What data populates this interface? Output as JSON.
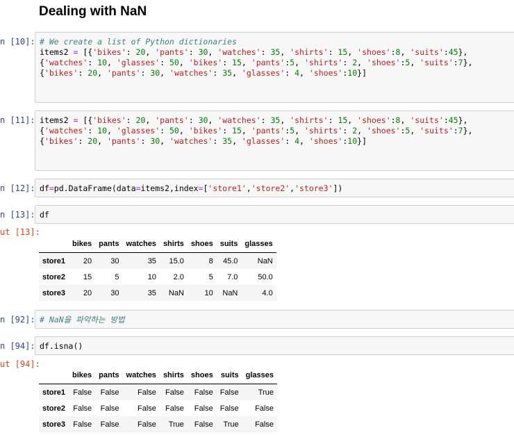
{
  "title": "Dealing with NaN",
  "cells": [
    {
      "prompt": "n [10]:",
      "lines": [
        [
          [
            "cm",
            "# We create a list of Python dictionaries"
          ]
        ],
        [
          [
            "",
            "items2 "
          ],
          [
            "op",
            "="
          ],
          [
            "",
            " [{"
          ],
          [
            "st",
            "'bikes'"
          ],
          [
            "",
            ": "
          ],
          [
            "nu",
            "20"
          ],
          [
            "",
            ", "
          ],
          [
            "st",
            "'pants'"
          ],
          [
            "",
            ": "
          ],
          [
            "nu",
            "30"
          ],
          [
            "",
            ", "
          ],
          [
            "st",
            "'watches'"
          ],
          [
            "",
            ": "
          ],
          [
            "nu",
            "35"
          ],
          [
            "",
            ", "
          ],
          [
            "st",
            "'shirts'"
          ],
          [
            "",
            ": "
          ],
          [
            "nu",
            "15"
          ],
          [
            "",
            ", "
          ],
          [
            "st",
            "'shoes'"
          ],
          [
            "",
            ":"
          ],
          [
            "nu",
            "8"
          ],
          [
            "",
            ", "
          ],
          [
            "st",
            "'suits'"
          ],
          [
            "",
            ":"
          ],
          [
            "nu",
            "45"
          ],
          [
            "",
            "},"
          ]
        ],
        [
          [
            "",
            "{"
          ],
          [
            "st",
            "'watches'"
          ],
          [
            "",
            ": "
          ],
          [
            "nu",
            "10"
          ],
          [
            "",
            ", "
          ],
          [
            "st",
            "'glasses'"
          ],
          [
            "",
            ": "
          ],
          [
            "nu",
            "50"
          ],
          [
            "",
            ", "
          ],
          [
            "st",
            "'bikes'"
          ],
          [
            "",
            ": "
          ],
          [
            "nu",
            "15"
          ],
          [
            "",
            ", "
          ],
          [
            "st",
            "'pants'"
          ],
          [
            "",
            ":"
          ],
          [
            "nu",
            "5"
          ],
          [
            "",
            ", "
          ],
          [
            "st",
            "'shirts'"
          ],
          [
            "",
            ": "
          ],
          [
            "nu",
            "2"
          ],
          [
            "",
            ", "
          ],
          [
            "st",
            "'shoes'"
          ],
          [
            "",
            ":"
          ],
          [
            "nu",
            "5"
          ],
          [
            "",
            ", "
          ],
          [
            "st",
            "'suits'"
          ],
          [
            "",
            ":"
          ],
          [
            "nu",
            "7"
          ],
          [
            "",
            "},"
          ]
        ],
        [
          [
            "",
            "{"
          ],
          [
            "st",
            "'bikes'"
          ],
          [
            "",
            ": "
          ],
          [
            "nu",
            "20"
          ],
          [
            "",
            ", "
          ],
          [
            "st",
            "'pants'"
          ],
          [
            "",
            ": "
          ],
          [
            "nu",
            "30"
          ],
          [
            "",
            ", "
          ],
          [
            "st",
            "'watches'"
          ],
          [
            "",
            ": "
          ],
          [
            "nu",
            "35"
          ],
          [
            "",
            ", "
          ],
          [
            "st",
            "'glasses'"
          ],
          [
            "",
            ": "
          ],
          [
            "nu",
            "4"
          ],
          [
            "",
            ", "
          ],
          [
            "st",
            "'shoes'"
          ],
          [
            "",
            ":"
          ],
          [
            "nu",
            "10"
          ],
          [
            "",
            "}]"
          ]
        ]
      ]
    },
    {
      "prompt": "n [11]:",
      "lines": [
        [
          [
            "",
            "items2 "
          ],
          [
            "op",
            "="
          ],
          [
            "",
            " [{"
          ],
          [
            "st",
            "'bikes'"
          ],
          [
            "",
            ": "
          ],
          [
            "nu",
            "20"
          ],
          [
            "",
            ", "
          ],
          [
            "st",
            "'pants'"
          ],
          [
            "",
            ": "
          ],
          [
            "nu",
            "30"
          ],
          [
            "",
            ", "
          ],
          [
            "st",
            "'watches'"
          ],
          [
            "",
            ": "
          ],
          [
            "nu",
            "35"
          ],
          [
            "",
            ", "
          ],
          [
            "st",
            "'shirts'"
          ],
          [
            "",
            ": "
          ],
          [
            "nu",
            "15"
          ],
          [
            "",
            ", "
          ],
          [
            "st",
            "'shoes'"
          ],
          [
            "",
            ":"
          ],
          [
            "nu",
            "8"
          ],
          [
            "",
            ", "
          ],
          [
            "st",
            "'suits'"
          ],
          [
            "",
            ":"
          ],
          [
            "nu",
            "45"
          ],
          [
            "",
            "},"
          ]
        ],
        [
          [
            "",
            "{"
          ],
          [
            "st",
            "'watches'"
          ],
          [
            "",
            ": "
          ],
          [
            "nu",
            "10"
          ],
          [
            "",
            ", "
          ],
          [
            "st",
            "'glasses'"
          ],
          [
            "",
            ": "
          ],
          [
            "nu",
            "50"
          ],
          [
            "",
            ", "
          ],
          [
            "st",
            "'bikes'"
          ],
          [
            "",
            ": "
          ],
          [
            "nu",
            "15"
          ],
          [
            "",
            ", "
          ],
          [
            "st",
            "'pants'"
          ],
          [
            "",
            ":"
          ],
          [
            "nu",
            "5"
          ],
          [
            "",
            ", "
          ],
          [
            "st",
            "'shirts'"
          ],
          [
            "",
            ": "
          ],
          [
            "nu",
            "2"
          ],
          [
            "",
            ", "
          ],
          [
            "st",
            "'shoes'"
          ],
          [
            "",
            ":"
          ],
          [
            "nu",
            "5"
          ],
          [
            "",
            ", "
          ],
          [
            "st",
            "'suits'"
          ],
          [
            "",
            ":"
          ],
          [
            "nu",
            "7"
          ],
          [
            "",
            "},"
          ]
        ],
        [
          [
            "",
            "{"
          ],
          [
            "st",
            "'bikes'"
          ],
          [
            "",
            ": "
          ],
          [
            "nu",
            "20"
          ],
          [
            "",
            ", "
          ],
          [
            "st",
            "'pants'"
          ],
          [
            "",
            ": "
          ],
          [
            "nu",
            "30"
          ],
          [
            "",
            ", "
          ],
          [
            "st",
            "'watches'"
          ],
          [
            "",
            ": "
          ],
          [
            "nu",
            "35"
          ],
          [
            "",
            ", "
          ],
          [
            "st",
            "'glasses'"
          ],
          [
            "",
            ": "
          ],
          [
            "nu",
            "4"
          ],
          [
            "",
            ", "
          ],
          [
            "st",
            "'shoes'"
          ],
          [
            "",
            ":"
          ],
          [
            "nu",
            "10"
          ],
          [
            "",
            "}]"
          ]
        ]
      ]
    },
    {
      "prompt": "n [12]:",
      "lines": [
        [
          [
            "",
            "df"
          ],
          [
            "op",
            "="
          ],
          [
            "",
            "pd.DataFrame(data"
          ],
          [
            "op",
            "="
          ],
          [
            "",
            "items2,index"
          ],
          [
            "op",
            "="
          ],
          [
            "",
            "["
          ],
          [
            "st",
            "'store1'"
          ],
          [
            "",
            ","
          ],
          [
            "st",
            "'store2'"
          ],
          [
            "",
            ","
          ],
          [
            "st",
            "'store3'"
          ],
          [
            "",
            "])"
          ]
        ]
      ]
    },
    {
      "prompt": "n [13]:",
      "lines": [
        [
          [
            "",
            "df"
          ]
        ]
      ]
    },
    {
      "prompt": "n [92]:",
      "lines": [
        [
          [
            "cm",
            "# NaN을 파악하는 방법"
          ]
        ]
      ]
    },
    {
      "prompt": "n [94]:",
      "lines": [
        [
          [
            "",
            "df.isna()"
          ]
        ]
      ]
    }
  ],
  "outputs": [
    {
      "prompt": "ut [13]:",
      "columns": [
        "bikes",
        "pants",
        "watches",
        "shirts",
        "shoes",
        "suits",
        "glasses"
      ],
      "rows": [
        {
          "index": "store1",
          "values": [
            "20",
            "30",
            "35",
            "15.0",
            "8",
            "45.0",
            "NaN"
          ]
        },
        {
          "index": "store2",
          "values": [
            "15",
            "5",
            "10",
            "2.0",
            "5",
            "7.0",
            "50.0"
          ]
        },
        {
          "index": "store3",
          "values": [
            "20",
            "30",
            "35",
            "NaN",
            "10",
            "NaN",
            "4.0"
          ]
        }
      ]
    },
    {
      "prompt": "ut [94]:",
      "columns": [
        "bikes",
        "pants",
        "watches",
        "shirts",
        "shoes",
        "suits",
        "glasses"
      ],
      "rows": [
        {
          "index": "store1",
          "values": [
            "False",
            "False",
            "False",
            "False",
            "False",
            "False",
            "True"
          ]
        },
        {
          "index": "store2",
          "values": [
            "False",
            "False",
            "False",
            "False",
            "False",
            "False",
            "False"
          ]
        },
        {
          "index": "store3",
          "values": [
            "False",
            "False",
            "False",
            "True",
            "False",
            "True",
            "False"
          ]
        }
      ]
    }
  ]
}
